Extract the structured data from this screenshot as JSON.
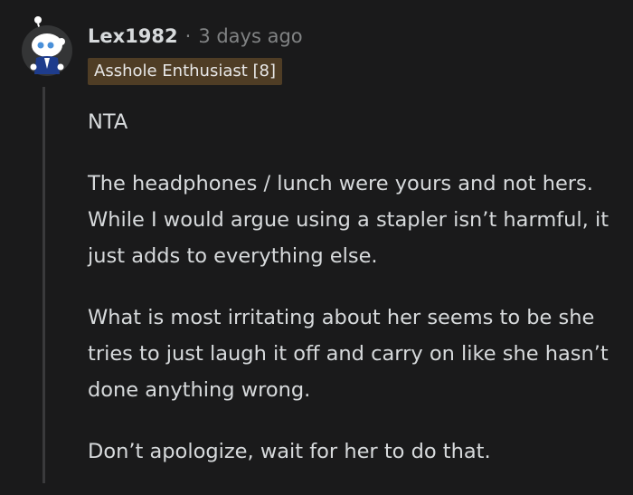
{
  "comment": {
    "author": "Lex1982",
    "separator": "·",
    "timestamp": "3 days ago",
    "flair": "Asshole Enthusiast [8]",
    "paragraphs": [
      "NTA",
      "The headphones / lunch were yours and not hers. While I would argue using a stapler isn’t harmful, it just adds to everything else.",
      "What is most irritating about her seems to be she tries to just laugh it off and carry on like she hasn’t done anything wrong.",
      "Don’t apologize, wait for her to do that."
    ]
  },
  "icons": {
    "avatar": "snoo-avatar-icon"
  },
  "colors": {
    "background": "#1a1a1b",
    "text": "#d7dadc",
    "meta": "#818384",
    "flair_bg": "#4f3d25",
    "thread_line": "#3a3a3c"
  }
}
